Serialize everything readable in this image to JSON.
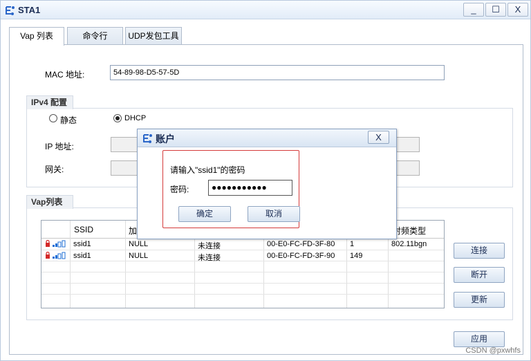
{
  "window": {
    "title": "STA1",
    "controls": {
      "minimize": "_",
      "maximize": "☐",
      "close": "X"
    }
  },
  "tabs": [
    {
      "label": "Vap 列表",
      "active": true
    },
    {
      "label": "命令行",
      "active": false
    },
    {
      "label": "UDP发包工具",
      "active": false
    }
  ],
  "mac": {
    "label": "MAC 地址:",
    "value": "54-89-98-D5-57-5D"
  },
  "ipv4": {
    "group_title": "IPv4 配置",
    "radio_static": "静态",
    "radio_dhcp": "DHCP",
    "selected": "DHCP",
    "ip_label": "IP 地址:",
    "gateway_label": "网关:"
  },
  "vap": {
    "group_title": "Vap列表",
    "columns": [
      "SSID",
      "加",
      "",
      "",
      "",
      "射频类型"
    ],
    "rows": [
      {
        "ssid": "ssid1",
        "encryption": "NULL",
        "status": "未连接",
        "bssid": "00-E0-FC-FD-3F-80",
        "channel": "1",
        "radio": "802.11bgn"
      },
      {
        "ssid": "ssid1",
        "encryption": "NULL",
        "status": "未连接",
        "bssid": "00-E0-FC-FD-3F-90",
        "channel": "149",
        "radio": ""
      }
    ],
    "buttons": {
      "connect": "连接",
      "disconnect": "断开",
      "refresh": "更新"
    }
  },
  "apply_button": "应用",
  "dialog": {
    "title": "账户",
    "close": "X",
    "prompt": "请输入\"ssid1\"的密码",
    "password_label": "密码:",
    "password_value": "●●●●●●●●●●●",
    "ok": "确定",
    "cancel": "取消"
  },
  "watermark": "CSDN @pxwhfs",
  "colors": {
    "highlight_frame": "#d43a3a",
    "title_bar": "#e2ecf8",
    "signal_blue": "#1f6fd6",
    "lock_red": "#d42a2a"
  }
}
